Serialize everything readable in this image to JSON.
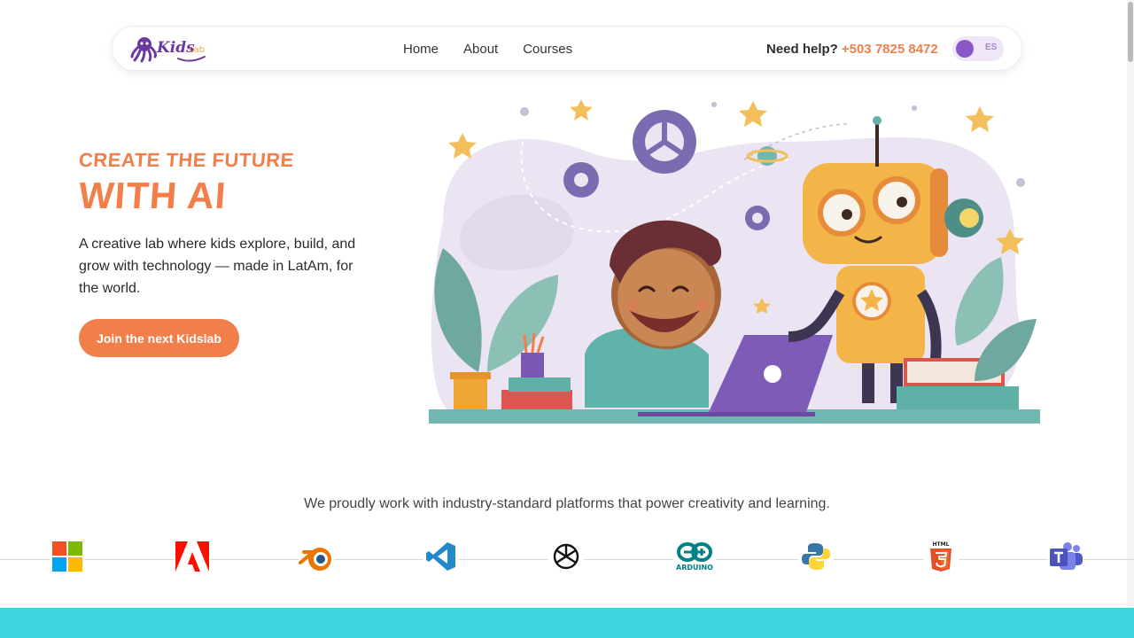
{
  "brand": {
    "logo_text_1": "Kids",
    "logo_text_2": "Lab"
  },
  "nav": {
    "links": [
      "Home",
      "About",
      "Courses"
    ]
  },
  "help": {
    "label": "Need help?",
    "phone": "+503 7825 8472"
  },
  "lang_toggle": {
    "label": "ES"
  },
  "hero": {
    "title_small": "CREATE THE FUTURE",
    "title_big": "WITH AI",
    "description": "A creative lab where kids explore, build, and grow with technology — made in LatAm, for the world.",
    "cta_label": "Join the next Kidslab"
  },
  "partners": {
    "heading": "We proudly work with industry-standard platforms that power creativity and learning.",
    "logos": [
      "microsoft-icon",
      "adobe-icon",
      "blender-icon",
      "vscode-icon",
      "openai-icon",
      "arduino-icon",
      "python-icon",
      "html5-icon",
      "teams-icon"
    ],
    "arduino_label": "ARDUINO",
    "html_label": "HTML"
  },
  "colors": {
    "accent": "#f27e4a",
    "purple": "#8a57c7",
    "teal": "#3dd3df"
  }
}
